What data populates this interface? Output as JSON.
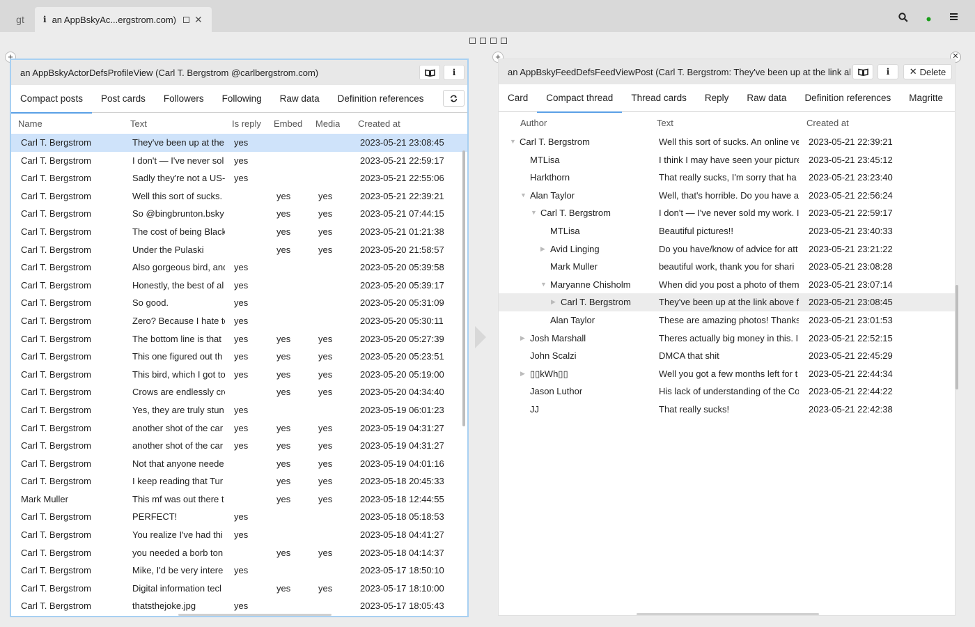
{
  "topbar": {
    "gt_label": "gt",
    "tab_title": "an AppBskyAc...ergstrom.com)",
    "status_color": "#1a9e1a"
  },
  "left_pane": {
    "title": "an AppBskyActorDefsProfileView (Carl T. Bergstrom @carlbergstrom.com)",
    "tabs": [
      "Compact posts",
      "Post cards",
      "Followers",
      "Following",
      "Raw data",
      "Definition references"
    ],
    "active_tab": "Compact posts",
    "columns": [
      "Name",
      "Text",
      "Is reply",
      "Embed",
      "Media",
      "Created at"
    ],
    "rows": [
      [
        "Carl T. Bergstrom",
        "They've been up at the",
        "yes",
        "",
        "",
        "2023-05-21 23:08:45"
      ],
      [
        "Carl T. Bergstrom",
        "I don't — I've never sol",
        "yes",
        "",
        "",
        "2023-05-21 22:59:17"
      ],
      [
        "Carl T. Bergstrom",
        "Sadly they're not a US-",
        "yes",
        "",
        "",
        "2023-05-21 22:55:06"
      ],
      [
        "Carl T. Bergstrom",
        "Well this sort of sucks.",
        "",
        "yes",
        "yes",
        "2023-05-21 22:39:21"
      ],
      [
        "Carl T. Bergstrom",
        "So @bingbrunton.bsky",
        "",
        "yes",
        "yes",
        "2023-05-21 07:44:15"
      ],
      [
        "Carl T. Bergstrom",
        "The cost of being Black",
        "",
        "yes",
        "yes",
        "2023-05-21 01:21:38"
      ],
      [
        "Carl T. Bergstrom",
        "Under the Pulaski",
        "",
        "yes",
        "yes",
        "2023-05-20 21:58:57"
      ],
      [
        "Carl T. Bergstrom",
        "Also gorgeous bird, and",
        "yes",
        "",
        "",
        "2023-05-20 05:39:58"
      ],
      [
        "Carl T. Bergstrom",
        "Honestly, the best of al",
        "yes",
        "",
        "",
        "2023-05-20 05:39:17"
      ],
      [
        "Carl T. Bergstrom",
        "So good.",
        "yes",
        "",
        "",
        "2023-05-20 05:31:09"
      ],
      [
        "Carl T. Bergstrom",
        "Zero? Because I hate to",
        "yes",
        "",
        "",
        "2023-05-20 05:30:11"
      ],
      [
        "Carl T. Bergstrom",
        "The bottom line is that",
        "yes",
        "yes",
        "yes",
        "2023-05-20 05:27:39"
      ],
      [
        "Carl T. Bergstrom",
        "This one figured out th",
        "yes",
        "yes",
        "yes",
        "2023-05-20 05:23:51"
      ],
      [
        "Carl T. Bergstrom",
        "This bird, which I got to",
        "yes",
        "yes",
        "yes",
        "2023-05-20 05:19:00"
      ],
      [
        "Carl T. Bergstrom",
        "Crows are endlessly cre",
        "",
        "yes",
        "yes",
        "2023-05-20 04:34:40"
      ],
      [
        "Carl T. Bergstrom",
        "Yes, they are truly stun",
        "yes",
        "",
        "",
        "2023-05-19 06:01:23"
      ],
      [
        "Carl T. Bergstrom",
        "another shot of the car",
        "yes",
        "yes",
        "yes",
        "2023-05-19 04:31:27"
      ],
      [
        "Carl T. Bergstrom",
        "another shot of the car",
        "yes",
        "yes",
        "yes",
        "2023-05-19 04:31:27"
      ],
      [
        "Carl T. Bergstrom",
        "Not that anyone neede",
        "",
        "yes",
        "yes",
        "2023-05-19 04:01:16"
      ],
      [
        "Carl T. Bergstrom",
        "I keep reading that Tur",
        "",
        "yes",
        "yes",
        "2023-05-18 20:45:33"
      ],
      [
        "Mark Muller",
        "This mf was out there t",
        "",
        "yes",
        "yes",
        "2023-05-18 12:44:55"
      ],
      [
        "Carl T. Bergstrom",
        "PERFECT!",
        "yes",
        "",
        "",
        "2023-05-18 05:18:53"
      ],
      [
        "Carl T. Bergstrom",
        "You realize I've had thi",
        "yes",
        "",
        "",
        "2023-05-18 04:41:27"
      ],
      [
        "Carl T. Bergstrom",
        "you needed a borb ton",
        "",
        "yes",
        "yes",
        "2023-05-18 04:14:37"
      ],
      [
        "Carl T. Bergstrom",
        "Mike, I'd be very intere",
        "yes",
        "",
        "",
        "2023-05-17 18:50:10"
      ],
      [
        "Carl T. Bergstrom",
        "Digital information tecl",
        "",
        "yes",
        "yes",
        "2023-05-17 18:10:00"
      ],
      [
        "Carl T. Bergstrom",
        "thatsthejoke.jpg",
        "yes",
        "",
        "",
        "2023-05-17 18:05:43"
      ]
    ]
  },
  "right_pane": {
    "title": "an AppBskyFeedDefsFeedViewPost (Carl T. Bergstrom: They've been up at the link ab",
    "delete_label": "Delete",
    "tabs": [
      "Card",
      "Compact thread",
      "Thread cards",
      "Reply",
      "Raw data",
      "Definition references",
      "Magritte"
    ],
    "active_tab": "Compact thread",
    "columns": [
      "Author",
      "Text",
      "Created at"
    ],
    "rows": [
      {
        "depth": 0,
        "toggle": "▼",
        "author": "Carl T. Bergstrom",
        "text": "Well this sort of sucks. An online ve",
        "created": "2023-05-21 22:39:21"
      },
      {
        "depth": 1,
        "toggle": "",
        "author": "MTLisa",
        "text": "I think I may have seen your picture",
        "created": "2023-05-21 23:45:12"
      },
      {
        "depth": 1,
        "toggle": "",
        "author": "Harkthorn",
        "text": "That really sucks, I'm sorry that ha",
        "created": "2023-05-21 23:23:40"
      },
      {
        "depth": 1,
        "toggle": "▼",
        "author": "Alan Taylor",
        "text": "Well, that's horrible. Do you have a",
        "created": "2023-05-21 22:56:24"
      },
      {
        "depth": 2,
        "toggle": "▼",
        "author": "Carl T. Bergstrom",
        "text": "I don't — I've never sold my work. I",
        "created": "2023-05-21 22:59:17"
      },
      {
        "depth": 3,
        "toggle": "",
        "author": "MTLisa",
        "text": "Beautiful pictures!!",
        "created": "2023-05-21 23:40:33"
      },
      {
        "depth": 3,
        "toggle": "▶",
        "author": "Avid Linging",
        "text": "Do you have/know of advice for att",
        "created": "2023-05-21 23:21:22"
      },
      {
        "depth": 3,
        "toggle": "",
        "author": "Mark Muller",
        "text": "beautiful work, thank you for shari",
        "created": "2023-05-21 23:08:28"
      },
      {
        "depth": 3,
        "toggle": "▼",
        "author": "Maryanne Chisholm",
        "text": "When did you post a photo of them",
        "created": "2023-05-21 23:07:14"
      },
      {
        "depth": 4,
        "toggle": "▶",
        "author": "Carl T. Bergstrom",
        "text": "They've been up at the link above f",
        "created": "2023-05-21 23:08:45"
      },
      {
        "depth": 3,
        "toggle": "",
        "author": "Alan Taylor",
        "text": "These are amazing photos! Thanks",
        "created": "2023-05-21 23:01:53"
      },
      {
        "depth": 1,
        "toggle": "▶",
        "author": "Josh Marshall",
        "text": "Theres actually big money in this. I",
        "created": "2023-05-21 22:52:15"
      },
      {
        "depth": 1,
        "toggle": "",
        "author": "John Scalzi",
        "text": "DMCA that shit",
        "created": "2023-05-21 22:45:29"
      },
      {
        "depth": 1,
        "toggle": "▶",
        "author": "▯▯kWh▯▯",
        "text": "Well you got a few months left for t",
        "created": "2023-05-21 22:44:34"
      },
      {
        "depth": 1,
        "toggle": "",
        "author": "Jason Luthor",
        "text": "His lack of understanding of the Co",
        "created": "2023-05-21 22:44:22"
      },
      {
        "depth": 1,
        "toggle": "",
        "author": "JJ",
        "text": "That really sucks!",
        "created": "2023-05-21 22:42:38"
      }
    ]
  }
}
